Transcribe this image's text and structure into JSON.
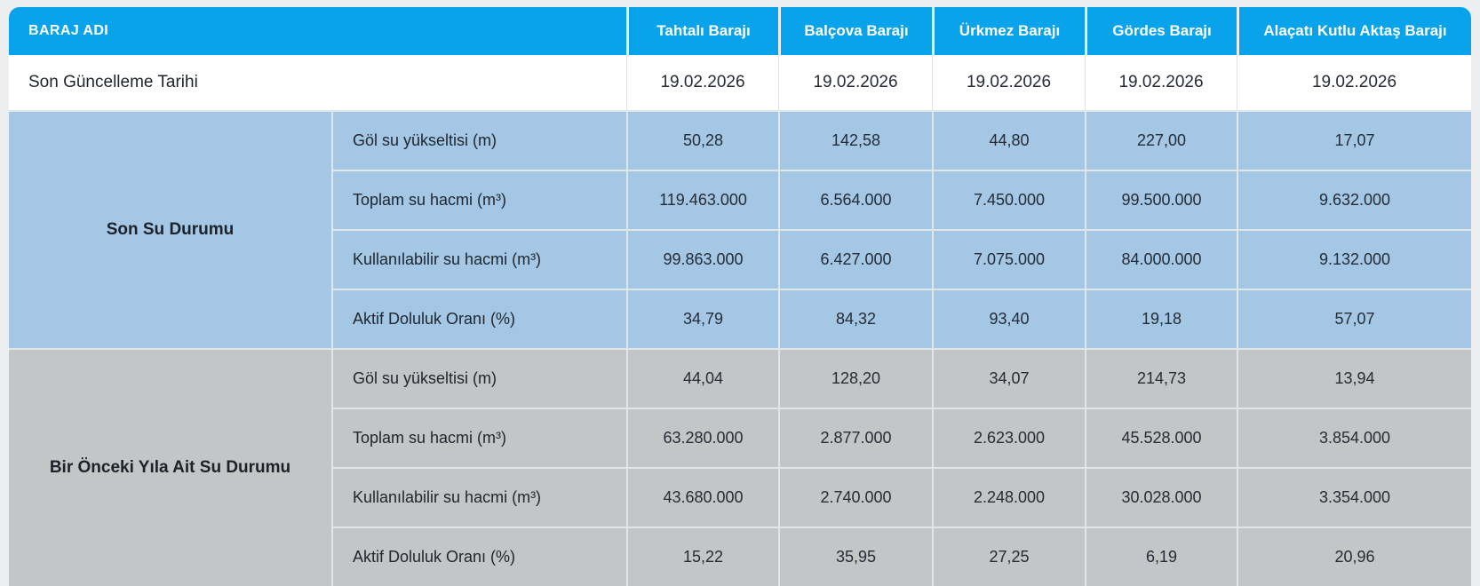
{
  "chart_data": {
    "type": "table",
    "corner_label": "BARAJ ADI",
    "columns": [
      "Tahtalı Barajı",
      "Balçova Barajı",
      "Ürkmez Barajı",
      "Gördes Barajı",
      "Alaçatı Kutlu Aktaş Barajı"
    ],
    "update_label": "Son Güncelleme Tarihi",
    "update_values": [
      "19.02.2026",
      "19.02.2026",
      "19.02.2026",
      "19.02.2026",
      "19.02.2026"
    ],
    "sections": [
      {
        "label": "Son Su Durumu",
        "rows": [
          {
            "label": "Göl su yükseltisi (m)",
            "values": [
              "50,28",
              "142,58",
              "44,80",
              "227,00",
              "17,07"
            ]
          },
          {
            "label": "Toplam su hacmi (m³)",
            "values": [
              "119.463.000",
              "6.564.000",
              "7.450.000",
              "99.500.000",
              "9.632.000"
            ]
          },
          {
            "label": "Kullanılabilir su hacmi (m³)",
            "values": [
              "99.863.000",
              "6.427.000",
              "7.075.000",
              "84.000.000",
              "9.132.000"
            ]
          },
          {
            "label": "Aktif Doluluk Oranı (%)",
            "values": [
              "34,79",
              "84,32",
              "93,40",
              "19,18",
              "57,07"
            ]
          }
        ]
      },
      {
        "label": "Bir Önceki Yıla Ait Su Durumu",
        "rows": [
          {
            "label": "Göl su yükseltisi (m)",
            "values": [
              "44,04",
              "128,20",
              "34,07",
              "214,73",
              "13,94"
            ]
          },
          {
            "label": "Toplam su hacmi (m³)",
            "values": [
              "63.280.000",
              "2.877.000",
              "2.623.000",
              "45.528.000",
              "3.854.000"
            ]
          },
          {
            "label": "Kullanılabilir su hacmi (m³)",
            "values": [
              "43.680.000",
              "2.740.000",
              "2.248.000",
              "30.028.000",
              "3.354.000"
            ]
          },
          {
            "label": "Aktif Doluluk Oranı (%)",
            "values": [
              "15,22",
              "35,95",
              "27,25",
              "6,19",
              "20,96"
            ]
          }
        ]
      }
    ],
    "colors": {
      "header_bg": "#09A3EC",
      "recent_section_bg": "#A3C7E5",
      "previous_section_bg": "#C4C5C6",
      "page_bg": "#EDEEF0"
    }
  }
}
